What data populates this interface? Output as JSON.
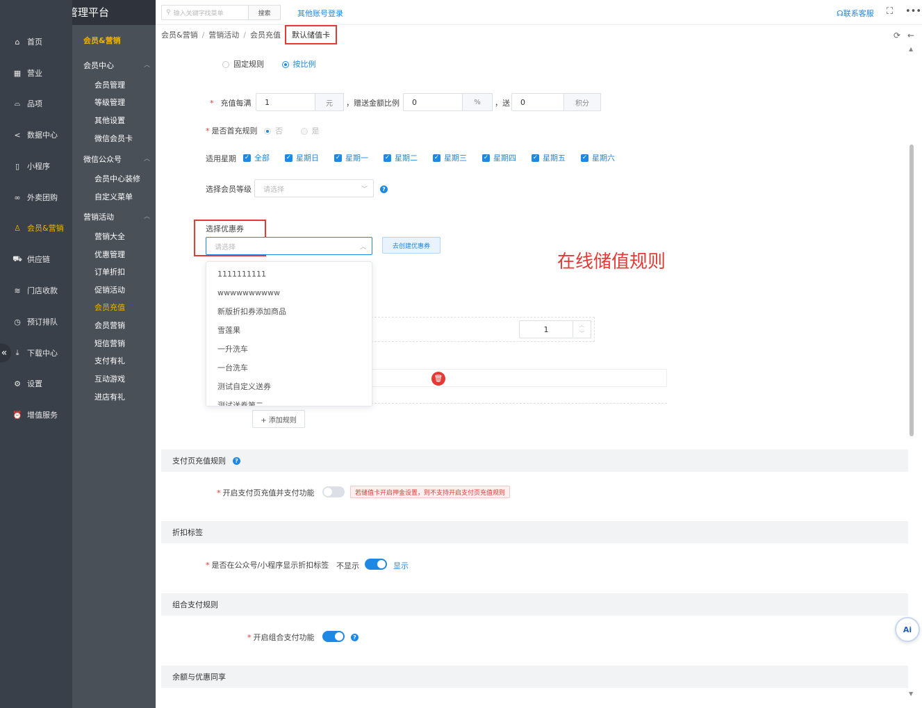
{
  "app": {
    "title": "商户管理平台"
  },
  "topbar": {
    "search_placeholder": "输入关键字找菜单",
    "search_button": "搜索",
    "other_login": "其他账号登录",
    "contact": "联系客服"
  },
  "sidebar": {
    "items": [
      {
        "label": "首页",
        "icon": "home-icon"
      },
      {
        "label": "营业",
        "icon": "calendar-icon"
      },
      {
        "label": "品项",
        "icon": "bag-icon"
      },
      {
        "label": "数据中心",
        "icon": "share-icon"
      },
      {
        "label": "小程序",
        "icon": "phone-icon"
      },
      {
        "label": "外卖团购",
        "icon": "bike-icon"
      },
      {
        "label": "会员&营销",
        "icon": "user-icon"
      },
      {
        "label": "供应链",
        "icon": "truck-icon"
      },
      {
        "label": "门店收款",
        "icon": "coins-icon"
      },
      {
        "label": "预订排队",
        "icon": "clock-icon"
      },
      {
        "label": "下载中心",
        "icon": "download-icon"
      },
      {
        "label": "设置",
        "icon": "gear-icon"
      },
      {
        "label": "增值服务",
        "icon": "alarm-icon"
      }
    ],
    "active": "会员&营销"
  },
  "subnav": {
    "title": "会员&营销",
    "groups": [
      {
        "label": "会员中心",
        "items": [
          "会员管理",
          "等级管理",
          "其他设置",
          "微信会员卡"
        ]
      },
      {
        "label": "微信公众号",
        "items": [
          "会员中心装修",
          "自定义菜单"
        ]
      },
      {
        "label": "营销活动",
        "items": [
          "营销大全",
          "优惠管理",
          "订单折扣",
          "促销活动",
          "会员充值",
          "会员营销",
          "短信营销",
          "支付有礼",
          "互动游戏",
          "进店有礼"
        ]
      }
    ],
    "active": "会员充值"
  },
  "breadcrumb": [
    "会员&营销",
    "营销活动",
    "会员充值",
    "默认储值卡"
  ],
  "form": {
    "rule_type": {
      "options": [
        "固定规则",
        "按比例"
      ],
      "selected": "按比例"
    },
    "recharge": {
      "label": "充值每满",
      "amount": "1",
      "amount_unit": "元",
      "ratio_label": "，赠送金额比例",
      "ratio": "0",
      "ratio_unit": "%",
      "give_label": "，送",
      "points": "0",
      "points_unit": "积分"
    },
    "first_recharge": {
      "label": "是否首充规则",
      "options": [
        "否",
        "是"
      ],
      "selected": "否"
    },
    "weekdays": {
      "label": "适用星期",
      "options": [
        "全部",
        "星期日",
        "星期一",
        "星期二",
        "星期三",
        "星期四",
        "星期五",
        "星期六"
      ]
    },
    "member_level": {
      "label": "选择会员等级",
      "placeholder": "请选择"
    },
    "coupon": {
      "label": "选择优惠券",
      "placeholder": "请选择",
      "create_button": "去创建优惠券",
      "options": [
        "1111111111",
        "wwwwwwwwww",
        "新版折扣券添加商品",
        "雪莲果",
        "一升洗车",
        "一台洗车",
        "测试自定义送券",
        "测试送券第二"
      ]
    },
    "quantity": "1",
    "add_rule": "+ 添加规则",
    "annotation": "在线储值规则"
  },
  "sections": {
    "pay_page": {
      "title": "支付页充值规则",
      "switch_label": "开启支付页充值并支付功能",
      "warning": "若储值卡开启押金设置，则不支持开启支付页充值规则"
    },
    "discount_tag": {
      "title": "折扣标签",
      "switch_label": "是否在公众号/小程序显示折扣标签",
      "off_text": "不显示",
      "on_text": "显示"
    },
    "combo_pay": {
      "title": "组合支付规则",
      "switch_label": "开启组合支付功能"
    },
    "balance": {
      "title": "余额与优惠同享"
    }
  },
  "ai": {
    "label": "Ai"
  }
}
